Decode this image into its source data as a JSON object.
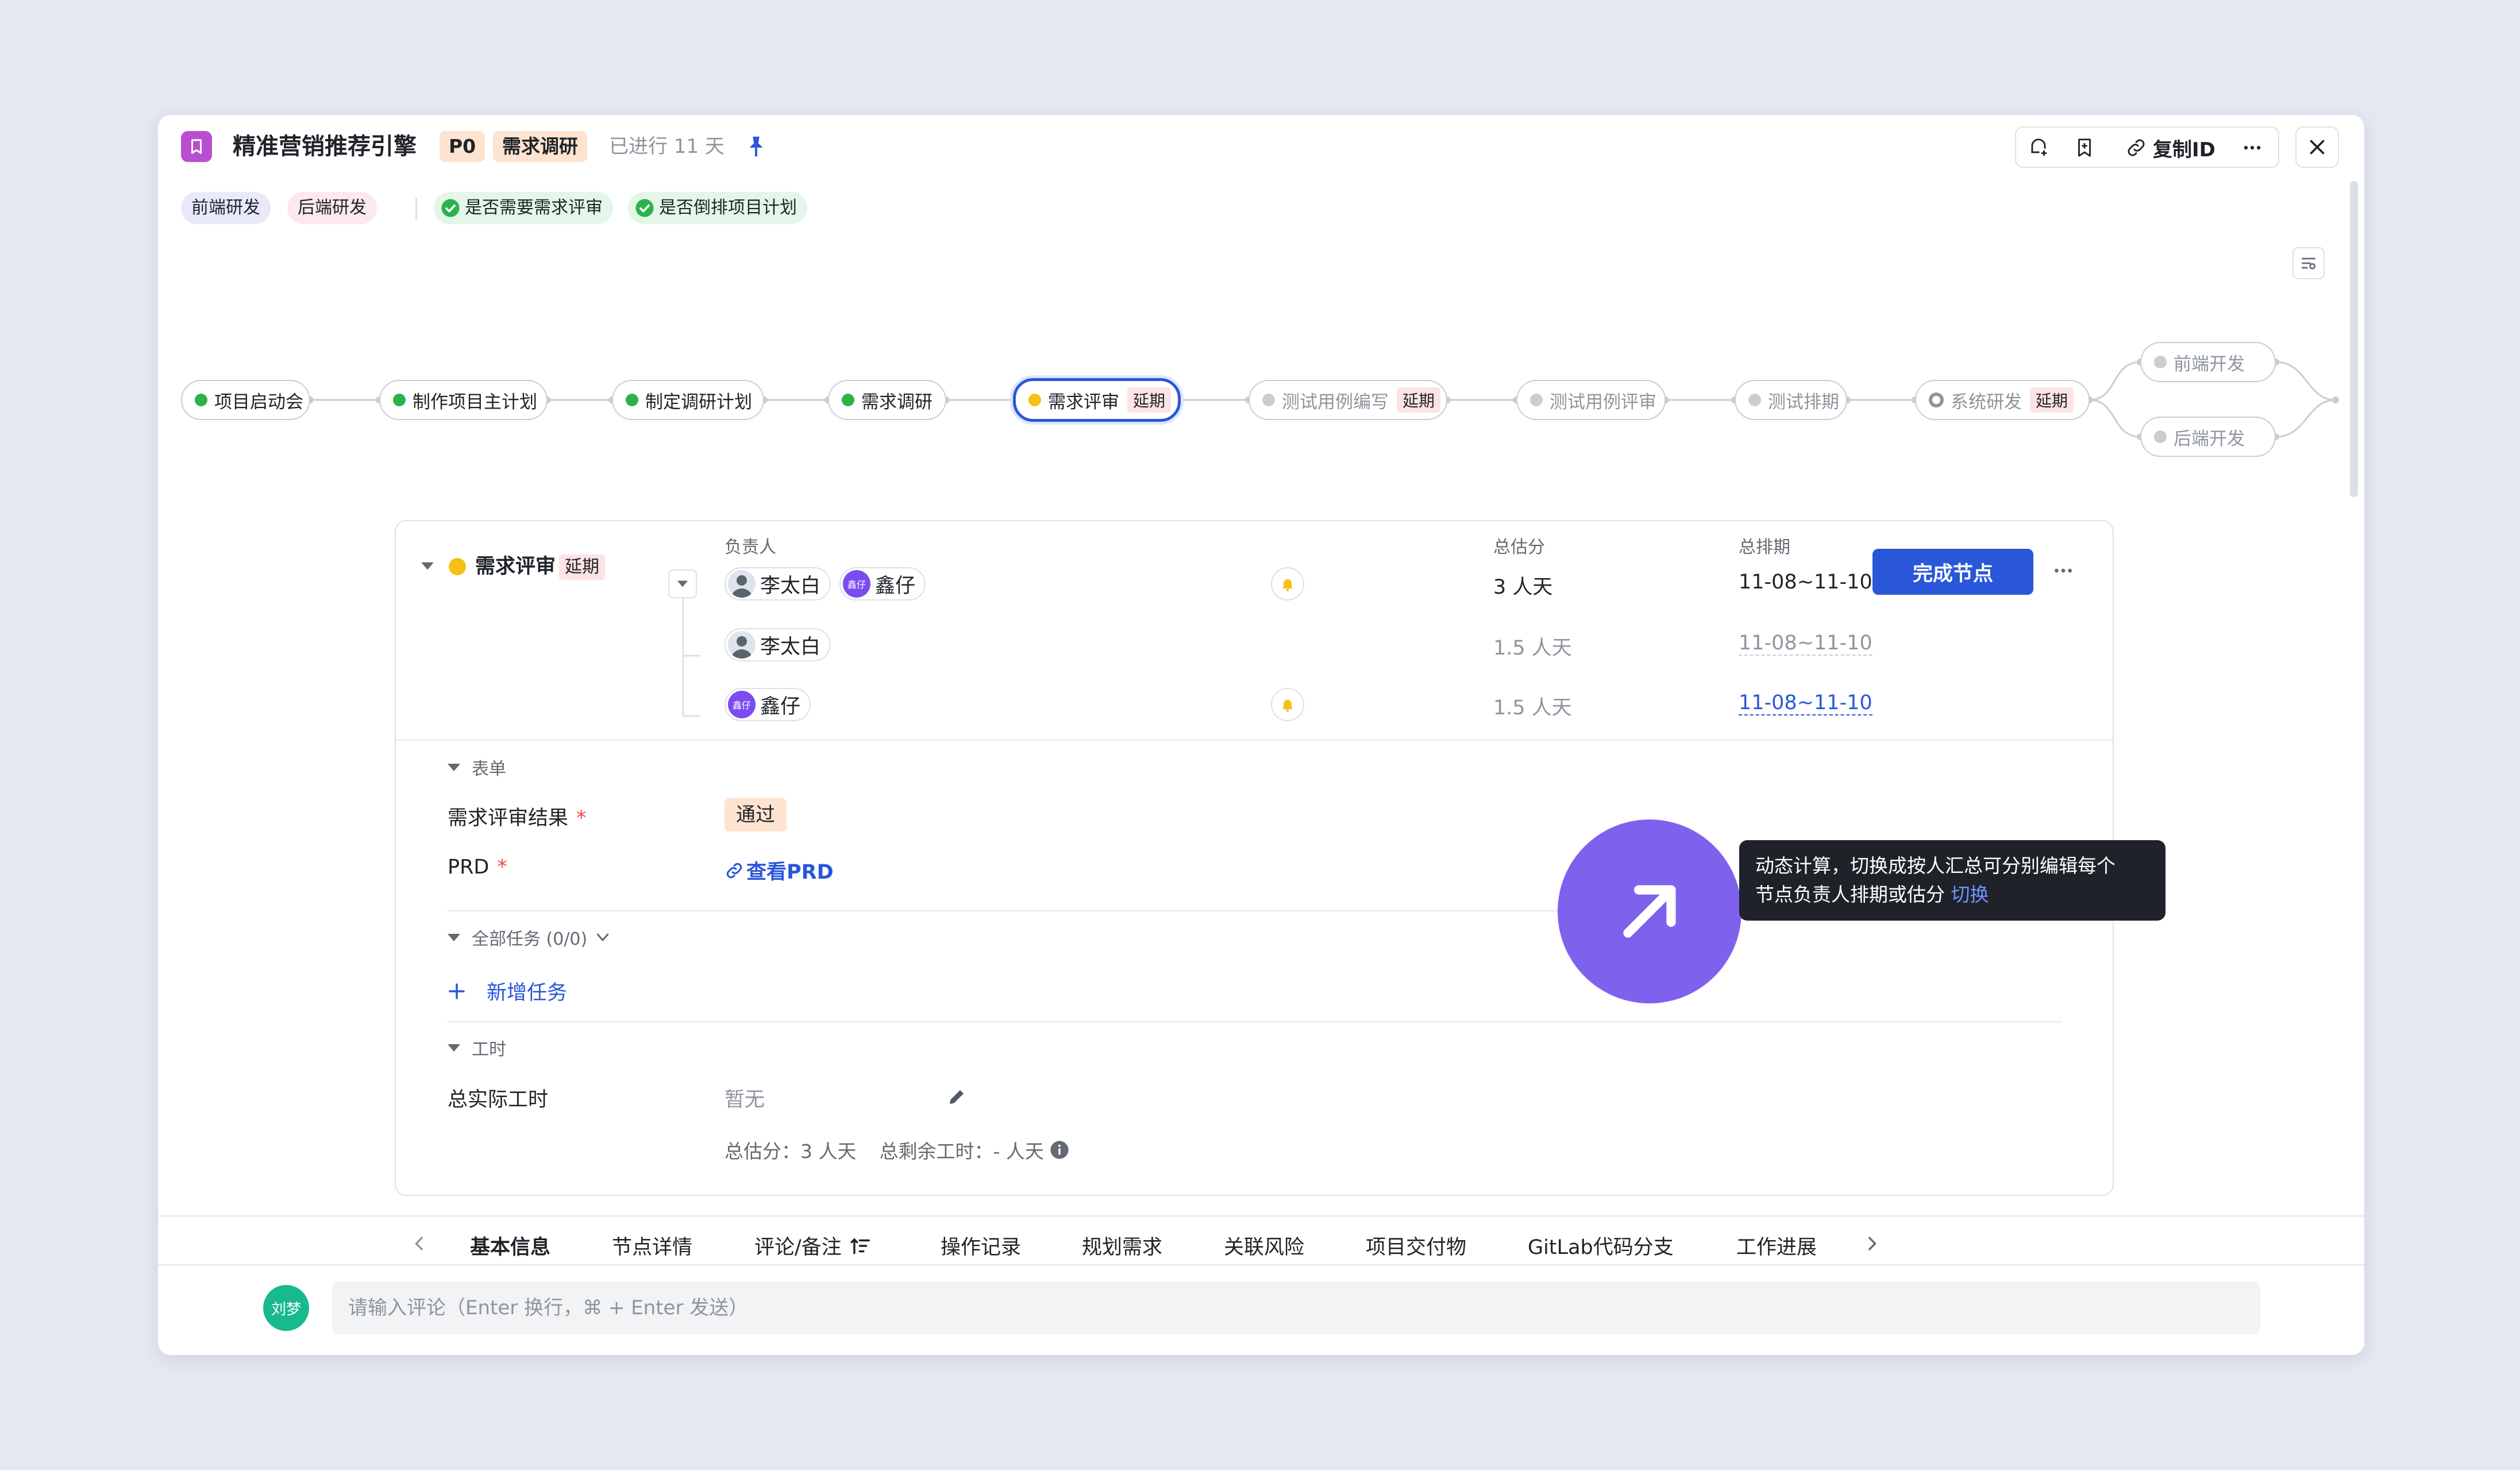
{
  "header": {
    "title": "精准营销推荐引擎",
    "priority": "P0",
    "stage": "需求调研",
    "elapsed": "已进行 11 天",
    "copy_id_label": "复制ID"
  },
  "tags": {
    "frontend": "前端研发",
    "backend": "后端研发",
    "check1": "是否需要需求评审",
    "check2": "是否倒排项目计划"
  },
  "flow": {
    "delay_label": "延期",
    "nodes": [
      {
        "label": "项目启动会"
      },
      {
        "label": "制作项目主计划"
      },
      {
        "label": "制定调研计划"
      },
      {
        "label": "需求调研"
      },
      {
        "label": "需求评审"
      },
      {
        "label": "测试用例编写"
      },
      {
        "label": "测试用例评审"
      },
      {
        "label": "测试排期"
      },
      {
        "label": "系统研发"
      },
      {
        "label": "前端开发"
      },
      {
        "label": "后端开发"
      }
    ]
  },
  "detail": {
    "node_name": "需求评审",
    "delay": "延期",
    "col_owner": "负责人",
    "col_estimate": "总估分",
    "col_schedule": "总排期",
    "owners": [
      {
        "name": "李太白"
      },
      {
        "name": "鑫仔",
        "avatar_text": "鑫仔"
      }
    ],
    "total_estimate": "3 人天",
    "total_schedule": "11-08~11-10",
    "rows": [
      {
        "name": "李太白",
        "estimate": "1.5 人天",
        "schedule": "11-08~11-10"
      },
      {
        "name": "鑫仔",
        "avatar_text": "鑫仔",
        "estimate": "1.5 人天",
        "schedule": "11-08~11-10"
      }
    ],
    "complete_button": "完成节点",
    "form_section": "表单",
    "review_result_label": "需求评审结果",
    "review_result_value": "通过",
    "prd_label": "PRD",
    "prd_link": "查看PRD",
    "required_mark": "*",
    "tasks_section": "全部任务 (0/0)",
    "add_task": "新增任务",
    "worktime_section": "工时",
    "actual_worktime_label": "总实际工时",
    "actual_worktime_value": "暂无",
    "summary_estimate": "总估分：3 人天",
    "summary_remaining": "总剩余工时：- 人天"
  },
  "tooltip": {
    "line1": "动态计算，切换成按人汇总可分别编辑每个",
    "line2": "节点负责人排期或估分",
    "switch_link": "切换"
  },
  "tabs": [
    "基本信息",
    "节点详情",
    "评论/备注",
    "操作记录",
    "规划需求",
    "关联风险",
    "项目交付物",
    "GitLab代码分支",
    "工作进展"
  ],
  "comment": {
    "avatar": "刘梦",
    "placeholder": "请输入评论（Enter 换行，⌘ + Enter 发送）"
  },
  "colors": {
    "primary": "#2a56d9",
    "done": "#2bb24c",
    "current": "#f7c018",
    "accent_circle": "#7e62ee",
    "app_icon": "#b84fd0"
  }
}
